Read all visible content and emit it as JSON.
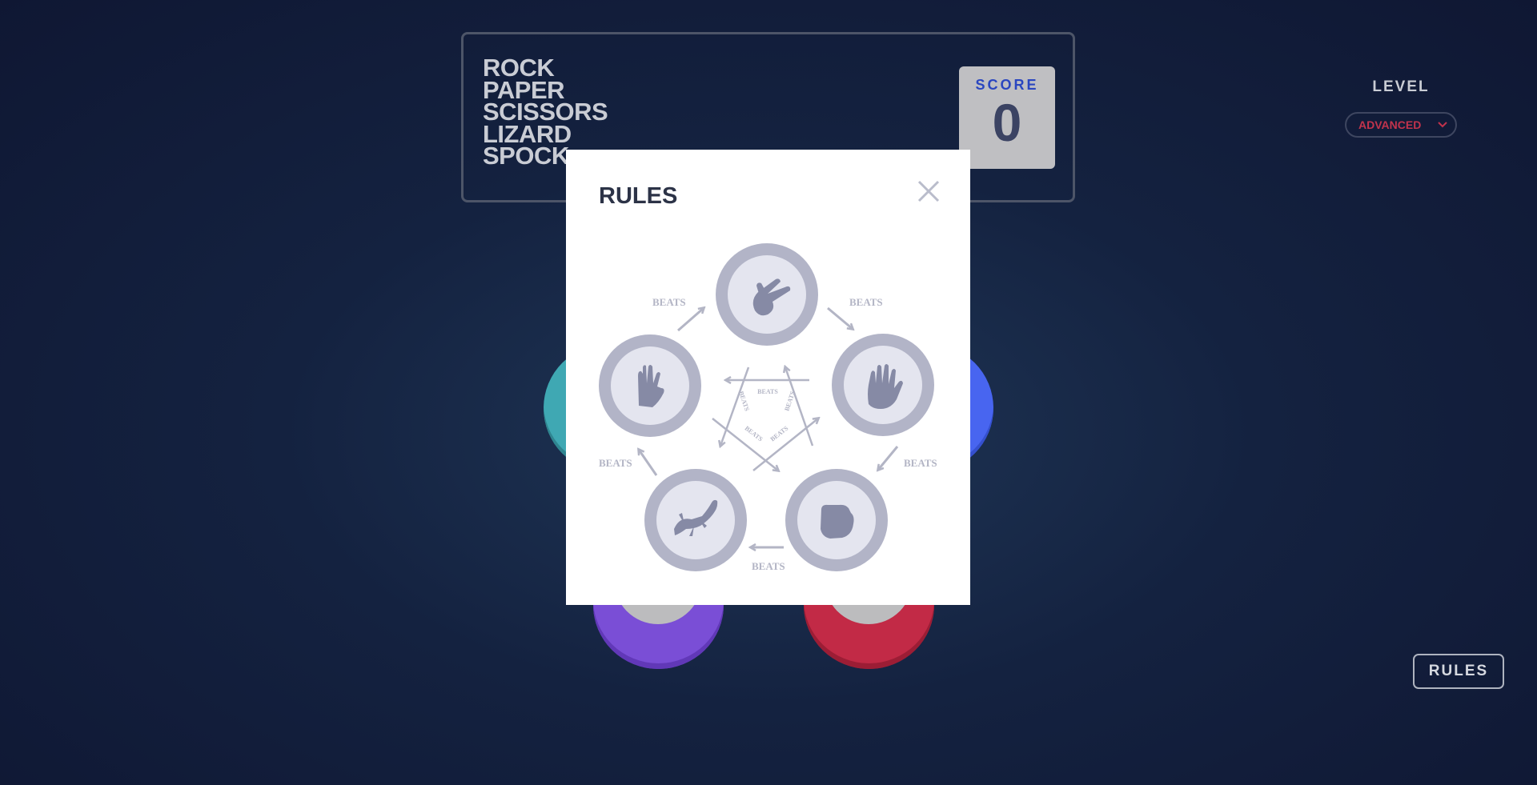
{
  "game": {
    "title_lines": [
      "ROCK",
      "PAPER",
      "SCISSORS",
      "LIZARD",
      "SPOCK"
    ],
    "score_label": "SCORE",
    "score_value": "0"
  },
  "level": {
    "label": "LEVEL",
    "selected": "ADVANCED"
  },
  "rules_button_label": "RULES",
  "board": {
    "tokens": [
      {
        "name": "spock",
        "color": "#40b9c5"
      },
      {
        "name": "scissors",
        "color": "#5671f5"
      },
      {
        "name": "lizard",
        "color": "#8856e4"
      },
      {
        "name": "rock",
        "color": "#dc2e4e"
      }
    ]
  },
  "modal": {
    "title": "RULES",
    "close_icon": "close-icon",
    "beats_label": "BEATS",
    "nodes": [
      "scissors",
      "paper",
      "rock",
      "lizard",
      "spock"
    ]
  },
  "colors": {
    "token_border": "#b2b4c7",
    "token_inner": "#e4e5ef",
    "hand_icon": "#868aa5",
    "arrow": "#b3b5c5"
  }
}
